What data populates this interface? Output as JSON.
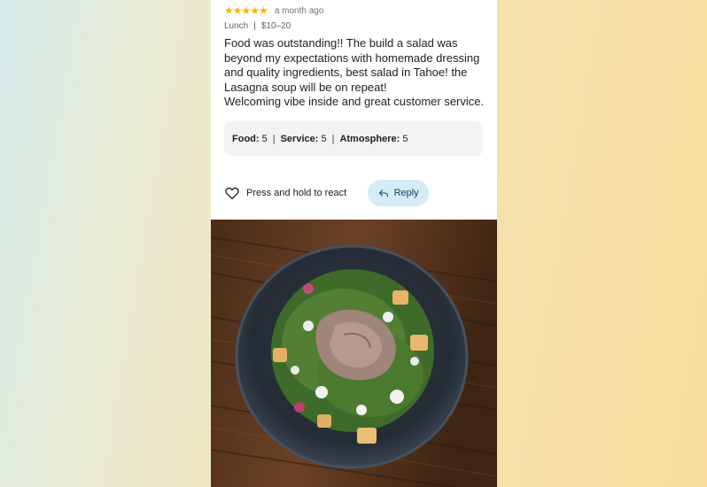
{
  "review": {
    "rating_stars": 5,
    "time_ago": "a month ago",
    "meal": "Lunch",
    "price": "$10–20",
    "text_line_1": "Food was outstanding!! The build a salad was beyond my expectations with homemade dressing and quality ingredients, best salad in Tahoe! the Lasagna soup will be on repeat!",
    "text_line_2": "Welcoming vibe inside and great customer service.",
    "ratings": [
      {
        "label": "Food:",
        "value": "5"
      },
      {
        "label": "Service:",
        "value": "5"
      },
      {
        "label": "Atmosphere:",
        "value": "5"
      }
    ]
  },
  "actions": {
    "react_label": "Press and hold to react",
    "reply_label": "Reply"
  },
  "icons": {
    "star": "star-icon",
    "heart": "heart-outline-icon",
    "reply": "reply-arrow-icon"
  },
  "colors": {
    "star": "#f4b400",
    "reply_bg": "#d3ecf7",
    "ratings_bg": "#f1f3f4"
  }
}
